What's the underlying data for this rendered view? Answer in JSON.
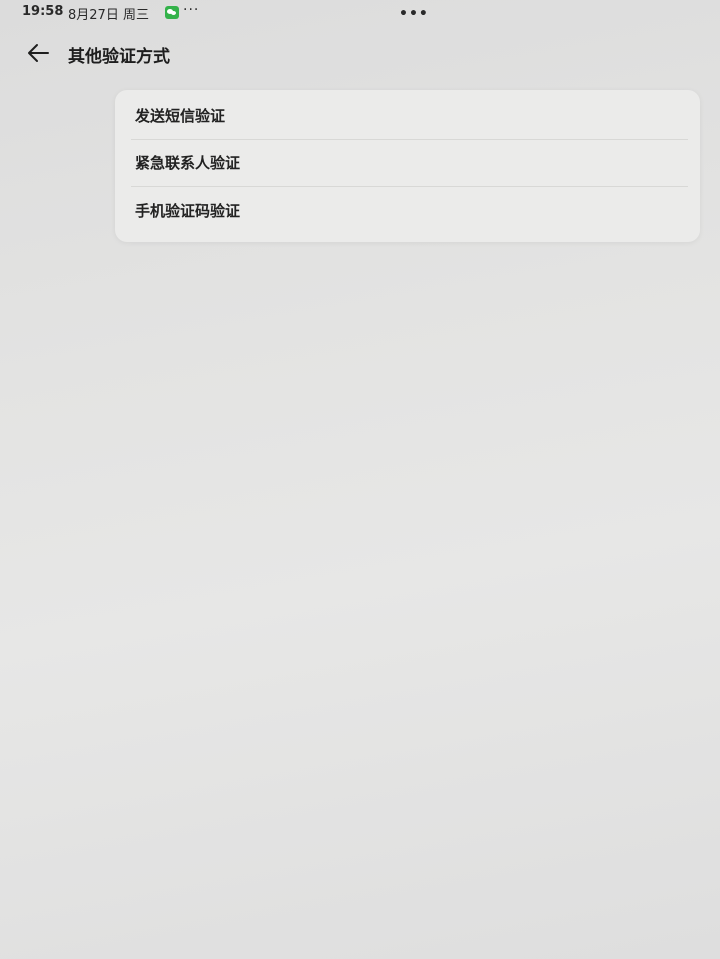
{
  "status_bar": {
    "time": "19:58",
    "date": "8月27日 周三",
    "notification_icon": "wechat-icon",
    "more_notifications": "···",
    "top_handle": "•••"
  },
  "header": {
    "back_icon": "arrow-left-icon",
    "title": "其他验证方式"
  },
  "menu": {
    "items": [
      {
        "label": "发送短信验证"
      },
      {
        "label": "紧急联系人验证"
      },
      {
        "label": "手机验证码验证"
      }
    ]
  },
  "colors": {
    "background": "#e3e3e2",
    "card": "#ebebea",
    "text": "#1e1e1e",
    "divider": "#d8d8d6",
    "wechat_green": "#34b24a"
  }
}
